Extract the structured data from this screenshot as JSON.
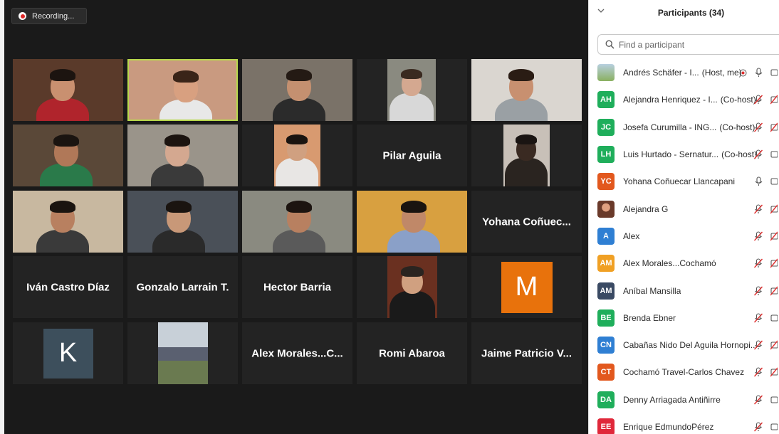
{
  "recording": {
    "label": "Recording..."
  },
  "panel": {
    "title": "Participants (34)",
    "search_placeholder": "Find a participant",
    "participants": [
      {
        "initials": "",
        "name": "Andrés Schäfer - I...",
        "role": "(Host, me)",
        "color": "#a9c4d8",
        "mic": "on",
        "video": "on",
        "photo": true,
        "recording_icon": true
      },
      {
        "initials": "AH",
        "name": "Alejandra Henriquez - I...",
        "role": "(Co-host)",
        "color": "#1fae5b",
        "mic": "muted",
        "video": "off"
      },
      {
        "initials": "JC",
        "name": "Josefa Curumilla - ING...",
        "role": "(Co-host)",
        "color": "#1fae5b",
        "mic": "muted",
        "video": "off"
      },
      {
        "initials": "LH",
        "name": "Luis Hurtado - Sernatur...",
        "role": "(Co-host)",
        "color": "#1fae5b",
        "mic": "muted",
        "video": "on"
      },
      {
        "initials": "YC",
        "name": "Yohana Coñuecar Llancapani",
        "role": "",
        "color": "#e2581e",
        "mic": "on",
        "video": "on"
      },
      {
        "initials": "",
        "name": "Alejandra G",
        "role": "",
        "color": "#7a4a3a",
        "mic": "muted",
        "video": "off",
        "photo": true
      },
      {
        "initials": "A",
        "name": "Alex",
        "role": "",
        "color": "#2f7fd3",
        "mic": "muted",
        "video": "off"
      },
      {
        "initials": "AM",
        "name": "Alex Morales...Cochamó",
        "role": "",
        "color": "#f0a024",
        "mic": "muted",
        "video": "off"
      },
      {
        "initials": "AM",
        "name": "Aníbal Mansilla",
        "role": "",
        "color": "#3a4a63",
        "mic": "muted",
        "video": "off"
      },
      {
        "initials": "BE",
        "name": "Brenda Ebner",
        "role": "",
        "color": "#1fae5b",
        "mic": "muted",
        "video": "on"
      },
      {
        "initials": "CN",
        "name": "Cabañas Nido Del Aguila Hornopi...",
        "role": "",
        "color": "#2f7fd3",
        "mic": "muted",
        "video": "off"
      },
      {
        "initials": "CT",
        "name": "Cochamó Travel-Carlos Chavez",
        "role": "",
        "color": "#e2581e",
        "mic": "muted",
        "video": "off"
      },
      {
        "initials": "DA",
        "name": "Denny Arriagada Antiñirre",
        "role": "",
        "color": "#1fae5b",
        "mic": "muted",
        "video": "on"
      },
      {
        "initials": "EE",
        "name": "Enrique EdmundoPérez",
        "role": "",
        "color": "#e0283a",
        "mic": "muted",
        "video": "on"
      }
    ]
  },
  "gallery": {
    "tiles": [
      {
        "type": "video",
        "scene": 0
      },
      {
        "type": "video",
        "scene": 1,
        "active": true
      },
      {
        "type": "video",
        "scene": 2
      },
      {
        "type": "video",
        "scene": 3
      },
      {
        "type": "video",
        "scene": 4
      },
      {
        "type": "video",
        "scene": 5
      },
      {
        "type": "video",
        "scene": 6
      },
      {
        "type": "video",
        "scene": 7
      },
      {
        "type": "name",
        "label": "Pilar Aguila"
      },
      {
        "type": "video",
        "scene": 8
      },
      {
        "type": "video",
        "scene": 9
      },
      {
        "type": "video",
        "scene": 10
      },
      {
        "type": "video",
        "scene": 11
      },
      {
        "type": "video",
        "scene": 12
      },
      {
        "type": "name",
        "label": "Yohana Coñuec..."
      },
      {
        "type": "name",
        "label": "Iván Castro Díaz"
      },
      {
        "type": "name",
        "label": "Gonzalo Larrain T."
      },
      {
        "type": "name",
        "label": "Hector Barria"
      },
      {
        "type": "video",
        "scene": 13
      },
      {
        "type": "monogram",
        "letter": "M",
        "color": "#e8720c"
      },
      {
        "type": "monogram",
        "letter": "K",
        "color": "#3d4f5c"
      },
      {
        "type": "video",
        "scene": 14
      },
      {
        "type": "name",
        "label": "Alex Morales...C..."
      },
      {
        "type": "name",
        "label": "Romi Abaroa"
      },
      {
        "type": "name",
        "label": "Jaime Patricio V..."
      }
    ]
  }
}
